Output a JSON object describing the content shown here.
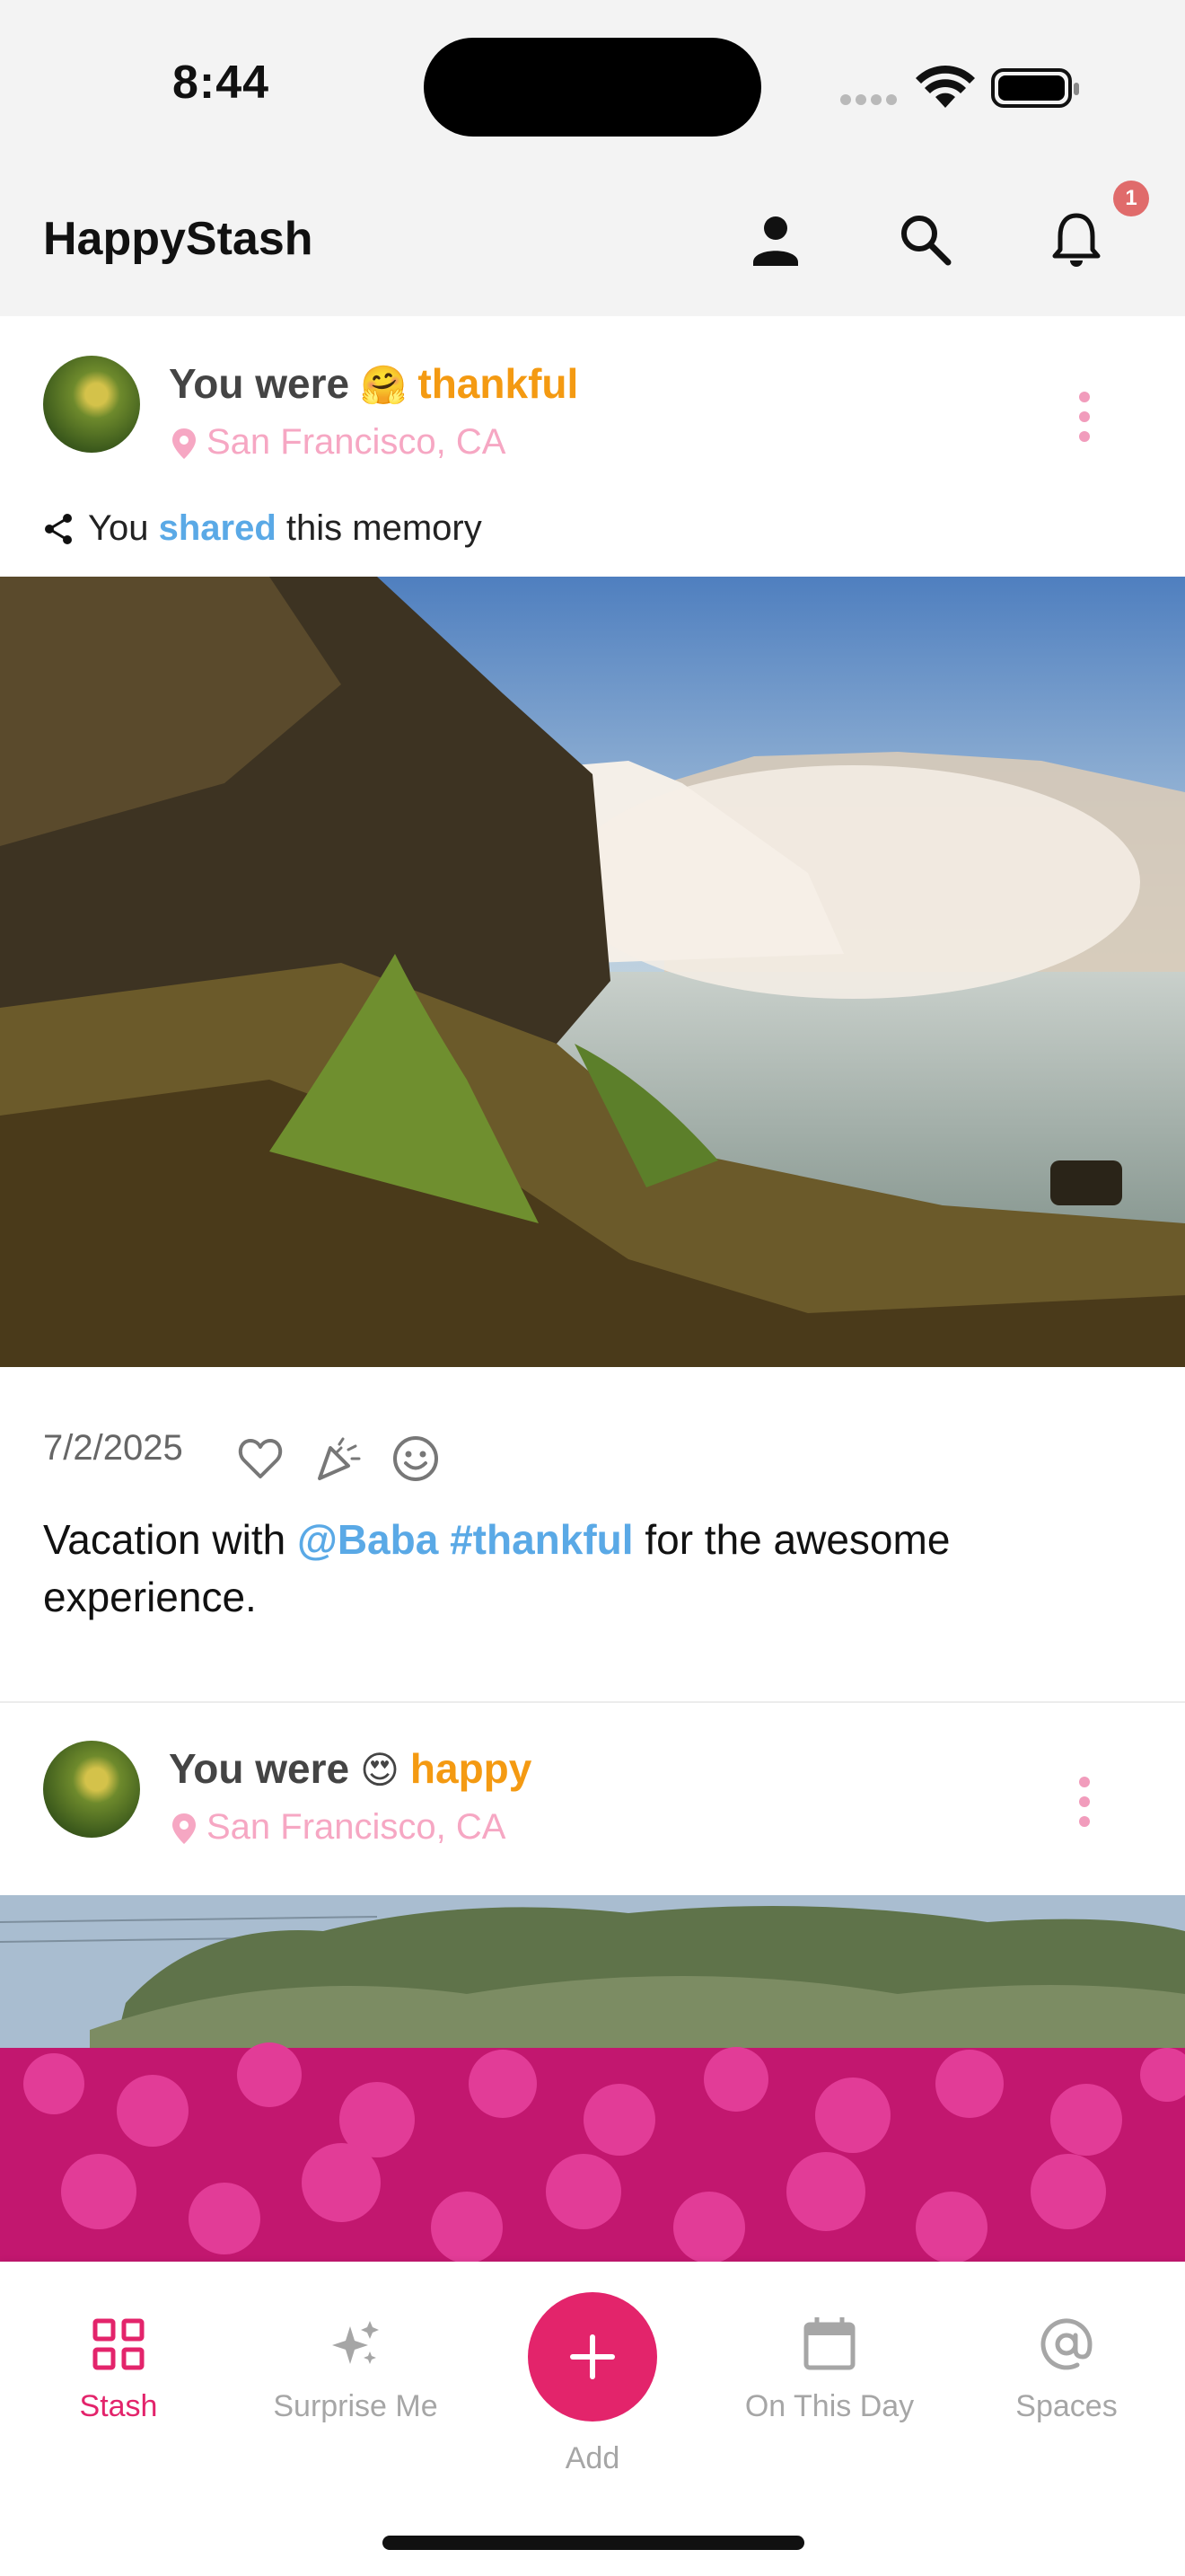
{
  "status_bar": {
    "time": "8:44"
  },
  "app": {
    "title": "HappyStash",
    "notification_count": "1"
  },
  "posts": [
    {
      "prefix": "You were",
      "emoji": "🤗",
      "mood": "thankful",
      "location": "San Francisco, CA",
      "share": {
        "before": "You",
        "link": "shared",
        "after": "this memory"
      },
      "date": "7/2/2025",
      "caption": {
        "before": "Vacation with",
        "mention": "@Baba",
        "hashtag": "#thankful",
        "after": "for the awesome experience."
      }
    },
    {
      "prefix": "You were",
      "emoji": "😍",
      "mood": "happy",
      "location": "San Francisco, CA"
    }
  ],
  "bottom_nav": {
    "items": [
      {
        "label": "Stash",
        "icon": "grid-icon",
        "active": true
      },
      {
        "label": "Surprise Me",
        "icon": "sparkles-icon",
        "active": false
      },
      {
        "label": "Add",
        "icon": "plus-icon",
        "active": false
      },
      {
        "label": "On This Day",
        "icon": "calendar-icon",
        "active": false
      },
      {
        "label": "Spaces",
        "icon": "at-icon",
        "active": false
      }
    ]
  },
  "colors": {
    "accent": "#e3246b",
    "mood": "#f49a12",
    "link": "#5aa9e6",
    "location": "#f6a7c3"
  }
}
